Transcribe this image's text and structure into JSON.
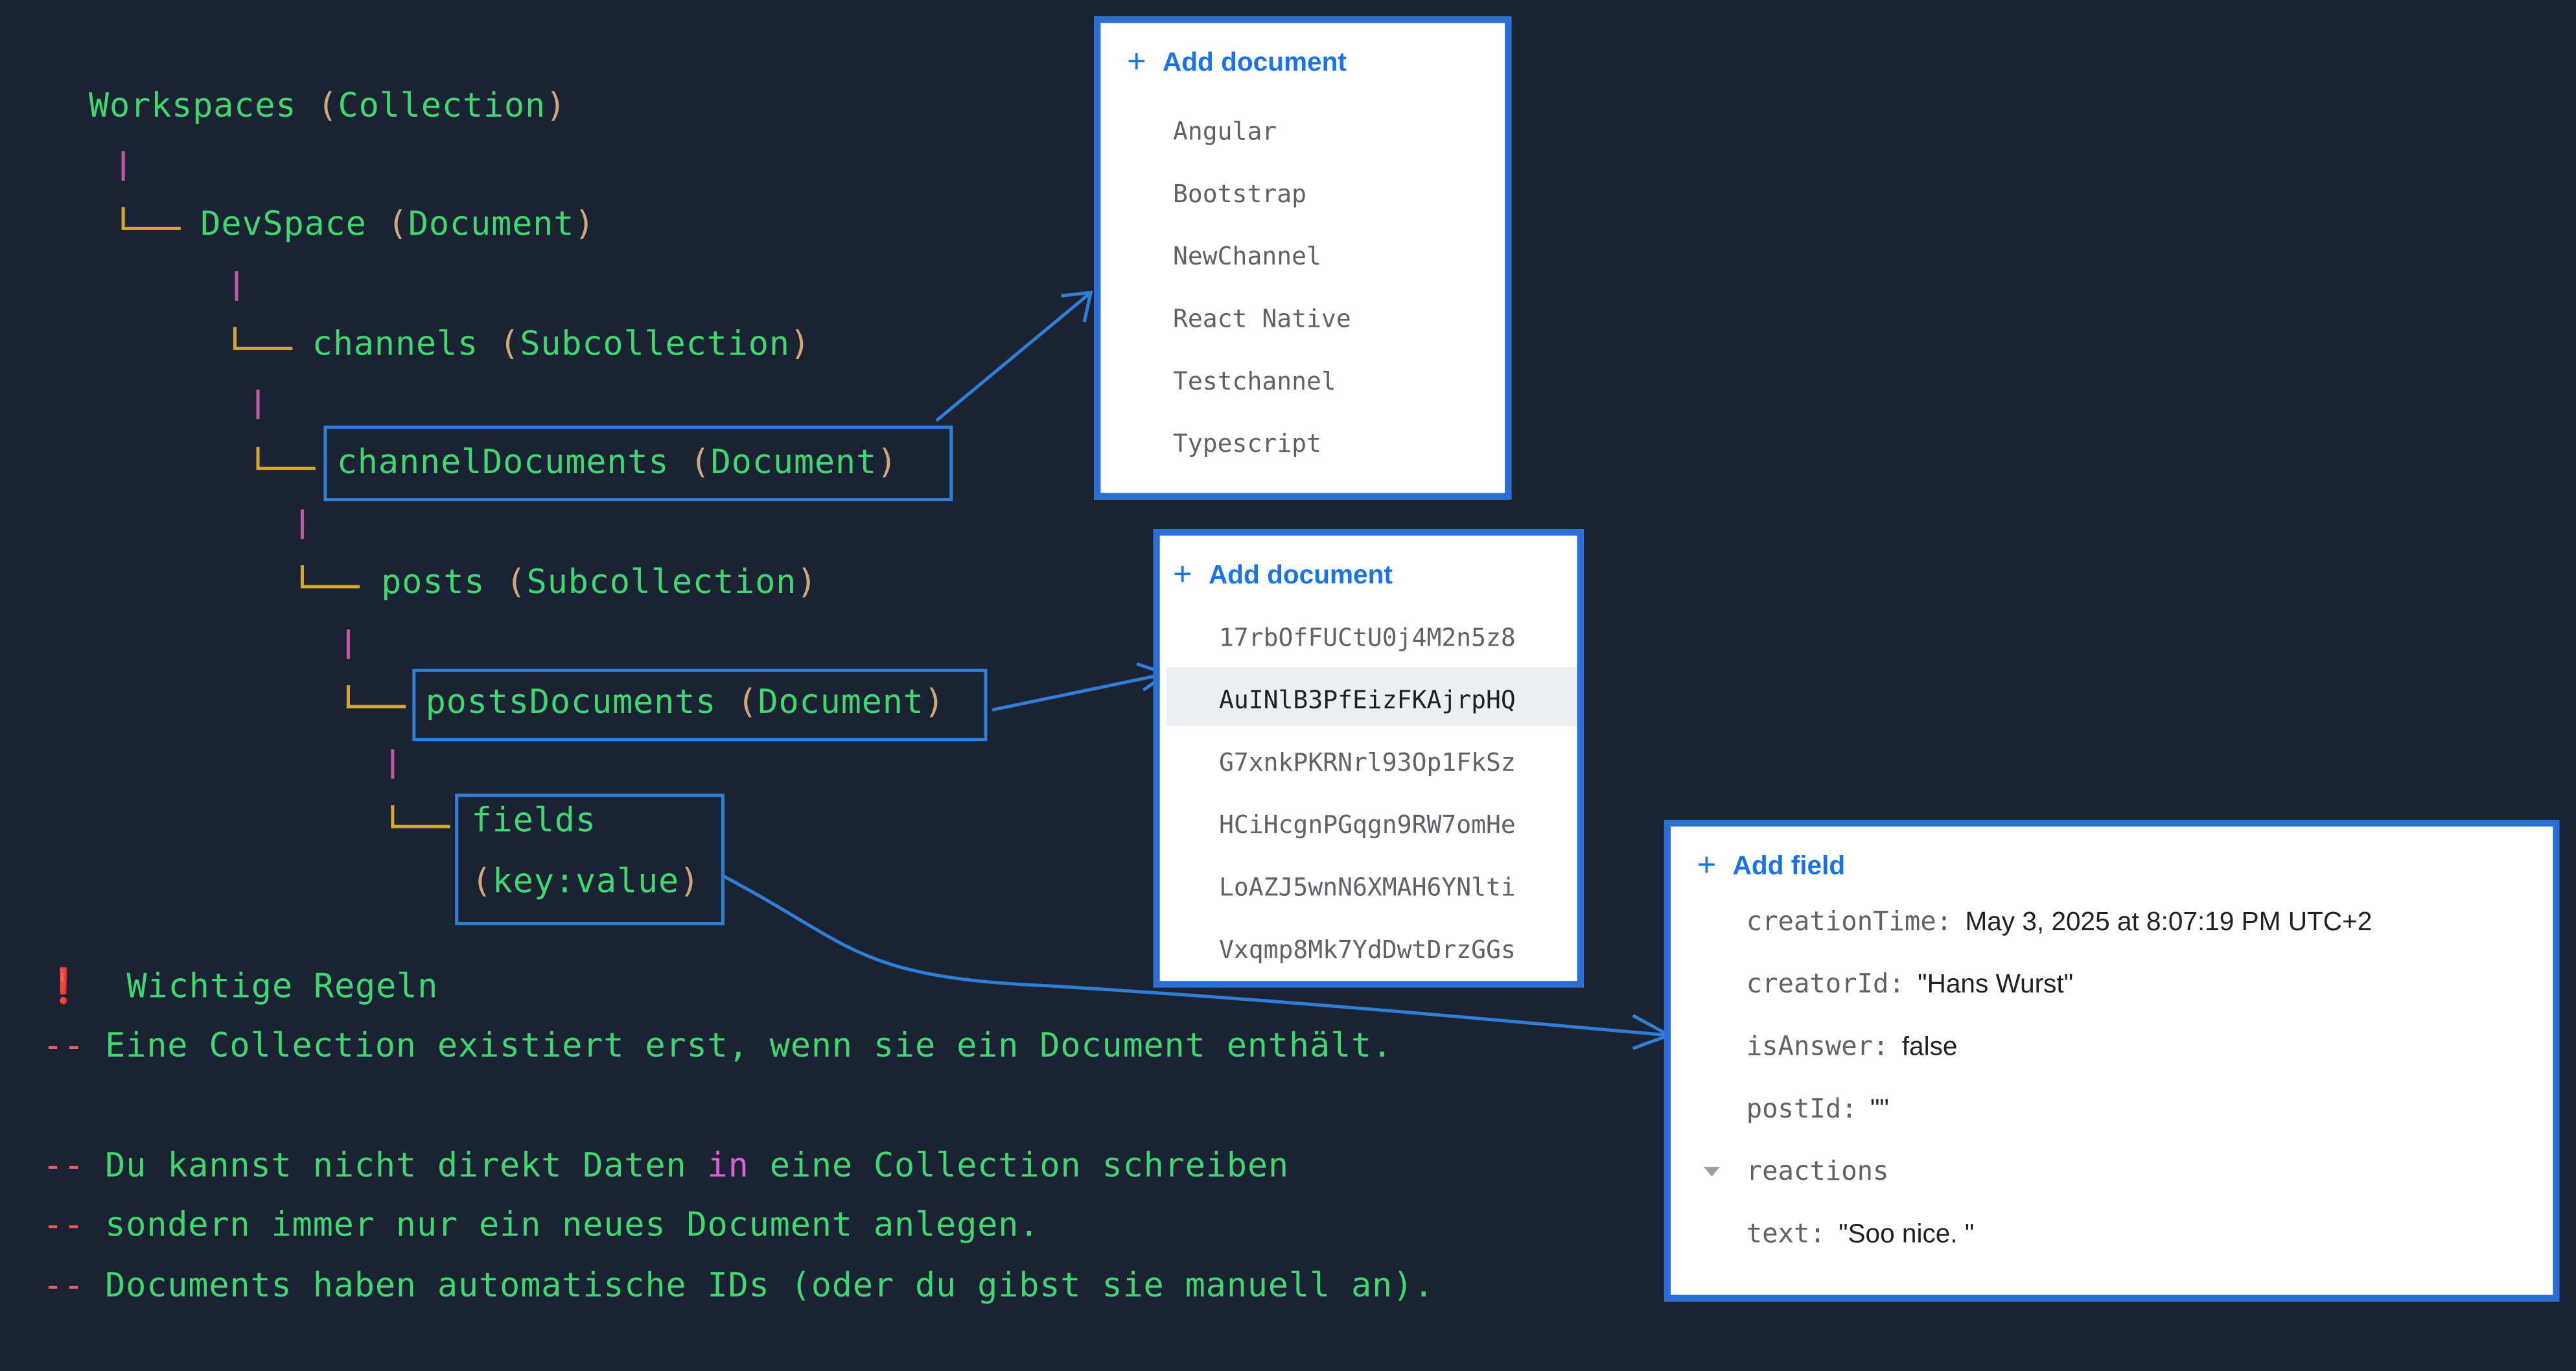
{
  "tree": {
    "workspaces": {
      "name": "Workspaces",
      "kind": "Collection"
    },
    "devspace": {
      "name": "DevSpace",
      "kind": "Document"
    },
    "channels": {
      "name": "channels",
      "kind": "Subcollection"
    },
    "channel_documents": {
      "name": "channelDocuments",
      "kind": "Document"
    },
    "posts": {
      "name": "posts",
      "kind": "Subcollection"
    },
    "posts_documents": {
      "name": "postsDocuments",
      "kind": "Document"
    },
    "fields": {
      "name": "fields",
      "kind": "key:value"
    }
  },
  "panel_channels": {
    "add_label": "Add document",
    "plus_icon": "+",
    "items": [
      "Angular",
      "Bootstrap",
      "NewChannel",
      "React Native",
      "Testchannel",
      "Typescript"
    ]
  },
  "panel_posts": {
    "add_label": "Add document",
    "plus_icon": "+",
    "selected": "AuINlB3PfEizFKAjrpHQ",
    "items": [
      "17rbOfFUCtU0j4M2n5z8",
      "AuINlB3PfEizFKAjrpHQ",
      "G7xnkPKRNrl93Op1FkSz",
      "HCiHcgnPGqgn9RW7omHe",
      "LoAZJ5wnN6XMAH6YNlti",
      "Vxqmp8Mk7YdDwtDrzGGs"
    ]
  },
  "panel_fields": {
    "add_label": "Add field",
    "plus_icon": "+",
    "fields": [
      {
        "key": "creationTime:",
        "value": "May 3, 2025 at 8:07:19 PM UTC+2"
      },
      {
        "key": "creatorId:",
        "value": "\"Hans Wurst\""
      },
      {
        "key": "isAnswer:",
        "value": "false"
      },
      {
        "key": "postId:",
        "value": "\"\""
      },
      {
        "key": "reactions",
        "value": ""
      },
      {
        "key": "text:",
        "value": "\"Soo nice. \""
      }
    ]
  },
  "rules": {
    "warning_icon": "❗",
    "heading": "Wichtige Regeln",
    "line1": "Eine Collection existiert erst, wenn sie ein Document enthält.",
    "line2a": "Du kannst nicht direkt Daten",
    "line2_kw": "in",
    "line2b": "eine Collection schreiben",
    "line3": "sondern immer nur ein neues Document anlegen.",
    "line4": "Documents haben automatische IDs (oder du gibst sie manuell an)."
  },
  "colors": {
    "background": "#1b2233",
    "code_green": "#3fd76e",
    "paren": "#cfa77a",
    "pipe": "#c05aa6",
    "elbow": "#d6a72f",
    "highlight_blue": "#2f7fd6",
    "link_blue": "#1a73e8"
  }
}
